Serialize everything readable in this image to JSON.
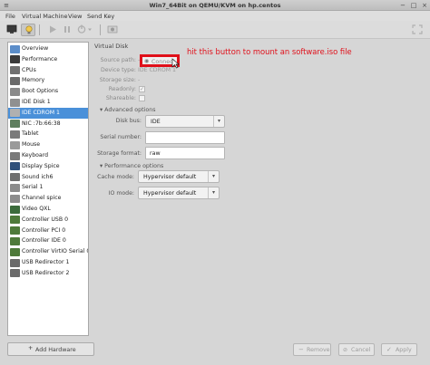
{
  "window": {
    "title": "Win7_64Bit on QEMU/KVM on hp.centos"
  },
  "menu": [
    "File",
    "Virtual Machine",
    "View",
    "Send Key"
  ],
  "toolbar": {
    "icons": [
      "monitor-icon",
      "lightbulb-icon",
      "play-icon",
      "pause-icon",
      "power-icon",
      "power-menu-icon",
      "screenshot-icon",
      "fullscreen-icon"
    ]
  },
  "sidebar": {
    "items": [
      {
        "label": "Overview",
        "icon": "info-icon",
        "color": "#5b8dc9"
      },
      {
        "label": "Performance",
        "icon": "chart-icon",
        "color": "#3a3a3a"
      },
      {
        "label": "CPUs",
        "icon": "cpu-icon",
        "color": "#707070"
      },
      {
        "label": "Memory",
        "icon": "memory-icon",
        "color": "#6a6a6a"
      },
      {
        "label": "Boot Options",
        "icon": "boot-icon",
        "color": "#8a8a8a"
      },
      {
        "label": "IDE Disk 1",
        "icon": "disk-icon",
        "color": "#909090"
      },
      {
        "label": "IDE CDROM 1",
        "icon": "cdrom-icon",
        "color": "#b0b0b0"
      },
      {
        "label": "NIC :7b:66:38",
        "icon": "nic-icon",
        "color": "#5f7f5f"
      },
      {
        "label": "Tablet",
        "icon": "tablet-icon",
        "color": "#7a7a7a"
      },
      {
        "label": "Mouse",
        "icon": "mouse-icon",
        "color": "#9a9a9a"
      },
      {
        "label": "Keyboard",
        "icon": "keyboard-icon",
        "color": "#7a7a7a"
      },
      {
        "label": "Display Spice",
        "icon": "display-icon",
        "color": "#2e4f7a"
      },
      {
        "label": "Sound ich6",
        "icon": "sound-icon",
        "color": "#6f6f6f"
      },
      {
        "label": "Serial 1",
        "icon": "serial-icon",
        "color": "#8c8c8c"
      },
      {
        "label": "Channel spice",
        "icon": "channel-icon",
        "color": "#8c8c8c"
      },
      {
        "label": "Video QXL",
        "icon": "video-icon",
        "color": "#3b6b3b"
      },
      {
        "label": "Controller USB 0",
        "icon": "controller-icon",
        "color": "#4e7a3a"
      },
      {
        "label": "Controller PCI 0",
        "icon": "controller-icon",
        "color": "#4e7a3a"
      },
      {
        "label": "Controller IDE 0",
        "icon": "controller-icon",
        "color": "#4e7a3a"
      },
      {
        "label": "Controller VirtIO Serial 0",
        "icon": "controller-icon",
        "color": "#4e7a3a"
      },
      {
        "label": "USB Redirector 1",
        "icon": "usb-icon",
        "color": "#6a6a6a"
      },
      {
        "label": "USB Redirector 2",
        "icon": "usb-icon",
        "color": "#6a6a6a"
      }
    ],
    "selected_index": 6,
    "add_label": "Add Hardware"
  },
  "virtual_disk": {
    "title": "Virtual Disk",
    "source_label": "Source path:",
    "source_value": "-",
    "connect_label": "Connect",
    "device_type_label": "Device type:",
    "device_type_value": "IDE CDROM 1",
    "storage_size_label": "Storage size:",
    "storage_size_value": "-",
    "readonly_label": "Readonly:",
    "readonly_checked": true,
    "shareable_label": "Shareable:",
    "shareable_checked": false
  },
  "advanced": {
    "title": "Advanced options",
    "disk_bus_label": "Disk bus:",
    "disk_bus_value": "IDE",
    "serial_label": "Serial number:",
    "serial_value": "",
    "format_label": "Storage format:",
    "format_value": "raw"
  },
  "performance": {
    "title": "Performance options",
    "cache_label": "Cache mode:",
    "cache_value": "Hypervisor default",
    "io_label": "IO mode:",
    "io_value": "Hypervisor default"
  },
  "annotation": {
    "text": "hit this button to mount an software.iso file",
    "color": "#e0101a"
  },
  "buttons": {
    "remove": "Remove",
    "cancel": "Cancel",
    "apply": "Apply"
  }
}
